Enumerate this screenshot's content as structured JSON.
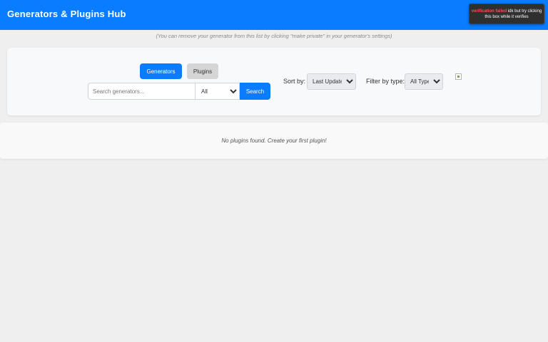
{
  "header": {
    "title": "Generators & Plugins Hub",
    "verification": {
      "status": "verification failed",
      "message": "idk but try clicking this box while it verifies"
    }
  },
  "note": "(You can remove your generator from this list by clicking \"make private\" in your generator's settings)",
  "controls": {
    "tabs": {
      "generators": "Generators",
      "plugins": "Plugins"
    },
    "search": {
      "placeholder": "Search generators...",
      "scope_selected": "All",
      "button": "Search"
    },
    "sort": {
      "label": "Sort by:",
      "selected": "Last Updated"
    },
    "filter": {
      "label": "Filter by type:",
      "selected": "All Types"
    }
  },
  "results": {
    "empty_message": "No plugins found. Create your first plugin!"
  },
  "colors": {
    "accent": "#0a7cff",
    "background": "#efefef",
    "card": "#f8f9fa"
  }
}
